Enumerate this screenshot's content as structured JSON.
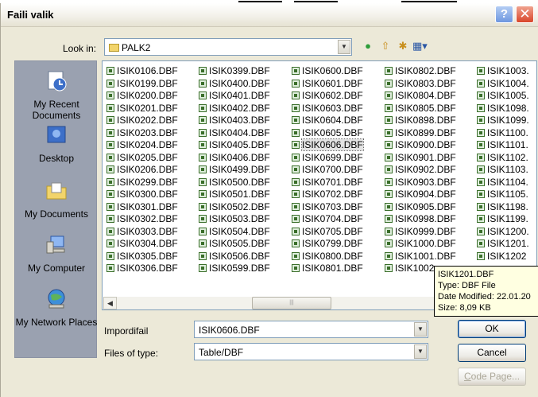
{
  "dialog": {
    "title": "Faili valik",
    "look_in_label": "Look in:",
    "look_in_value": "PALK2"
  },
  "places": [
    {
      "label": "My Recent Documents",
      "icon": "recent-documents-icon"
    },
    {
      "label": "Desktop",
      "icon": "desktop-icon"
    },
    {
      "label": "My Documents",
      "icon": "my-documents-icon"
    },
    {
      "label": "My Computer",
      "icon": "my-computer-icon"
    },
    {
      "label": "My Network Places",
      "icon": "network-places-icon"
    }
  ],
  "files": {
    "selected": "ISIK0606.DBF",
    "columns": [
      [
        "ISIK0106.DBF",
        "ISIK0199.DBF",
        "ISIK0200.DBF",
        "ISIK0201.DBF",
        "ISIK0202.DBF",
        "ISIK0203.DBF",
        "ISIK0204.DBF",
        "ISIK0205.DBF",
        "ISIK0206.DBF",
        "ISIK0299.DBF",
        "ISIK0300.DBF",
        "ISIK0301.DBF",
        "ISIK0302.DBF",
        "ISIK0303.DBF",
        "ISIK0304.DBF",
        "ISIK0305.DBF",
        "ISIK0306.DBF"
      ],
      [
        "ISIK0399.DBF",
        "ISIK0400.DBF",
        "ISIK0401.DBF",
        "ISIK0402.DBF",
        "ISIK0403.DBF",
        "ISIK0404.DBF",
        "ISIK0405.DBF",
        "ISIK0406.DBF",
        "ISIK0499.DBF",
        "ISIK0500.DBF",
        "ISIK0501.DBF",
        "ISIK0502.DBF",
        "ISIK0503.DBF",
        "ISIK0504.DBF",
        "ISIK0505.DBF",
        "ISIK0506.DBF",
        "ISIK0599.DBF"
      ],
      [
        "ISIK0600.DBF",
        "ISIK0601.DBF",
        "ISIK0602.DBF",
        "ISIK0603.DBF",
        "ISIK0604.DBF",
        "ISIK0605.DBF",
        "ISIK0606.DBF",
        "ISIK0699.DBF",
        "ISIK0700.DBF",
        "ISIK0701.DBF",
        "ISIK0702.DBF",
        "ISIK0703.DBF",
        "ISIK0704.DBF",
        "ISIK0705.DBF",
        "ISIK0799.DBF",
        "ISIK0800.DBF",
        "ISIK0801.DBF"
      ],
      [
        "ISIK0802.DBF",
        "ISIK0803.DBF",
        "ISIK0804.DBF",
        "ISIK0805.DBF",
        "ISIK0898.DBF",
        "ISIK0899.DBF",
        "ISIK0900.DBF",
        "ISIK0901.DBF",
        "ISIK0902.DBF",
        "ISIK0903.DBF",
        "ISIK0904.DBF",
        "ISIK0905.DBF",
        "ISIK0998.DBF",
        "ISIK0999.DBF",
        "ISIK1000.DBF",
        "ISIK1001.DBF",
        "ISIK1002"
      ],
      [
        "ISIK1003.",
        "ISIK1004.",
        "ISIK1005.",
        "ISIK1098.",
        "ISIK1099.",
        "ISIK1100.",
        "ISIK1101.",
        "ISIK1102.",
        "ISIK1103.",
        "ISIK1104.",
        "ISIK1105.",
        "ISIK1198.",
        "ISIK1199.",
        "ISIK1200.",
        "ISIK1201.",
        "ISIK1202"
      ]
    ]
  },
  "tooltip": {
    "name": "ISIK1201.DBF",
    "type": "Type: DBF File",
    "modified": "Date Modified: 22.01.20",
    "size": "Size: 8,09 KB"
  },
  "form": {
    "name_label": "Impordifail",
    "name_value": "ISIK0606.DBF",
    "type_label": "Files of type:",
    "type_value": "Table/DBF"
  },
  "buttons": {
    "ok": "OK",
    "cancel": "Cancel",
    "code_page_first": "C",
    "code_page_rest": "ode Page..."
  }
}
